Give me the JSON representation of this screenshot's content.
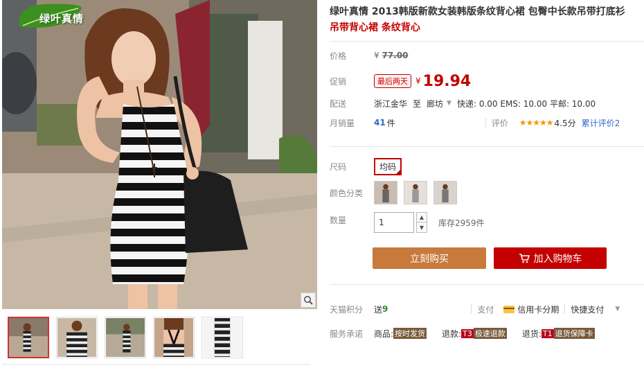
{
  "gallery": {
    "watermark": "绿叶真情",
    "thumbnails": [
      {
        "id": "thumb-1",
        "active": true
      },
      {
        "id": "thumb-2",
        "active": false
      },
      {
        "id": "thumb-3",
        "active": false
      },
      {
        "id": "thumb-4",
        "active": false
      },
      {
        "id": "thumb-5",
        "active": false
      }
    ],
    "zoom_icon": "magnifier-icon"
  },
  "product": {
    "title": "绿叶真情 2013韩版新款女装韩版条纹背心裙 包臀中长款吊带打底衫",
    "subtitle": "吊带背心裙 条纹背心"
  },
  "price": {
    "label": "价格",
    "currency": "¥",
    "original": "77.00"
  },
  "promo": {
    "label": "促销",
    "badge": "最后两天",
    "currency": "¥",
    "value": "19.94"
  },
  "shipping": {
    "label": "配送",
    "from": "浙江金华",
    "to_word": "至",
    "to": "廊坊",
    "fees": "快递: 0.00 EMS: 10.00 平邮: 10.00"
  },
  "sales": {
    "label": "月销量",
    "count": "41",
    "unit": "件",
    "rating_label": "评价",
    "stars": "★★★★★",
    "score": "4.5分",
    "reviews_link": "累计评价2"
  },
  "options": {
    "size_label": "尺码",
    "size_value": "均码",
    "color_label": "颜色分类",
    "colors": [
      "color-swatch-1",
      "color-swatch-2",
      "color-swatch-3"
    ],
    "qty_label": "数量",
    "qty_value": "1",
    "stock": "库存2959件"
  },
  "actions": {
    "buy": "立刻购买",
    "cart": "加入购物车"
  },
  "points": {
    "label": "天猫积分",
    "send": "送",
    "num": "9",
    "pay_label": "支付",
    "installment": "信用卡分期",
    "quick_pay": "快捷支付"
  },
  "services": {
    "label": "服务承诺",
    "items": [
      {
        "prefix": "商品:",
        "mark": "",
        "tag": "按时发货"
      },
      {
        "prefix": "退款:",
        "mark": "T3",
        "tag": "极速退款"
      },
      {
        "prefix": "退货:",
        "mark": "T1",
        "tag": "退货保障卡"
      }
    ]
  },
  "colors": {
    "accent_red": "#c40000",
    "buy_brown": "#c87a3c",
    "link_blue": "#3366cc",
    "star_orange": "#f39800"
  }
}
